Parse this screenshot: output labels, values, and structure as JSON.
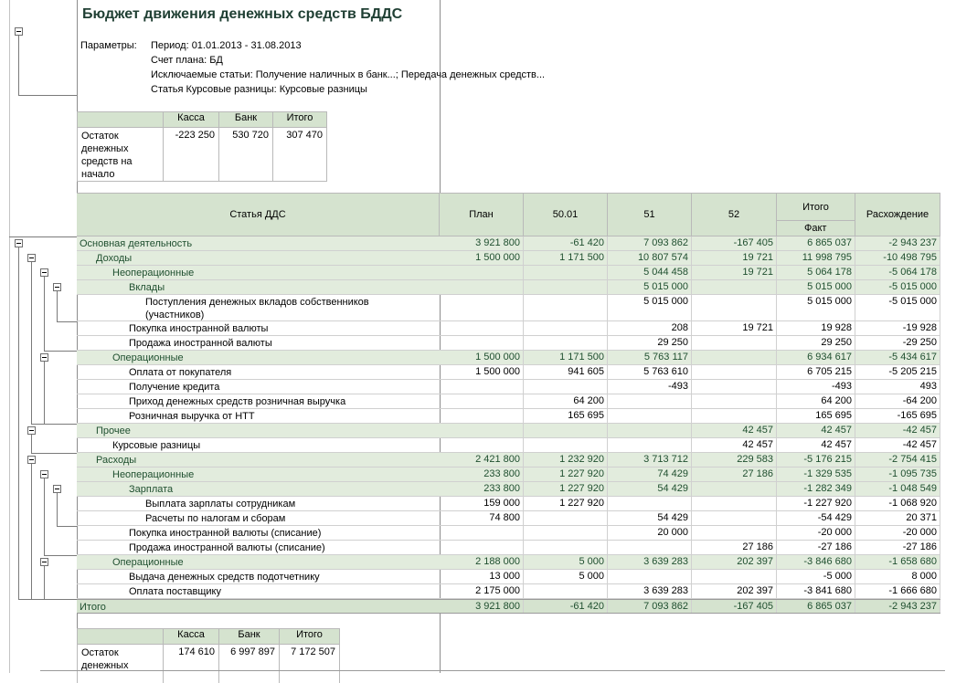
{
  "report": {
    "title": "Бюджет движения денежных средств БДДС",
    "params_label": "Параметры:",
    "params": [
      "Период: 01.01.2013 - 31.08.2013",
      "Счет плана: БД",
      "Исключаемые статьи: Получение наличных в банк...; Передача денежных средств...",
      "Статья Курсовые разницы: Курсовые разницы"
    ]
  },
  "opening_balance": {
    "headers": [
      "Касса",
      "Банк",
      "Итого"
    ],
    "label": "Остаток денежных средств на начало",
    "values": [
      "-223 250",
      "530 720",
      "307 470"
    ]
  },
  "main_table": {
    "headers": {
      "article": "Статья ДДС",
      "plan": "План",
      "c5001": "50.01",
      "c51": "51",
      "c52": "52",
      "total_group": "Итого",
      "fact": "Факт",
      "diff": "Расхождение"
    },
    "rows": [
      {
        "label": "Основная деятельность",
        "plan": "3 921 800",
        "c5001": "-61 420",
        "c51": "7 093 862",
        "c52": "-167 405",
        "fact": "6 865 037",
        "diff": "-2 943 237"
      },
      {
        "label": "Доходы",
        "plan": "1 500 000",
        "c5001": "1 171 500",
        "c51": "10 807 574",
        "c52": "19 721",
        "fact": "11 998 795",
        "diff": "-10 498 795"
      },
      {
        "label": "Неоперационные",
        "plan": "",
        "c5001": "",
        "c51": "5 044 458",
        "c52": "19 721",
        "fact": "5 064 178",
        "diff": "-5 064 178"
      },
      {
        "label": "Вклады",
        "plan": "",
        "c5001": "",
        "c51": "5 015 000",
        "c52": "",
        "fact": "5 015 000",
        "diff": "-5 015 000"
      },
      {
        "label_1": "Поступления денежных вкладов собственников",
        "label_2": "(участников)",
        "plan": "",
        "c5001": "",
        "c51": "5 015 000",
        "c52": "",
        "fact": "5 015 000",
        "diff": "-5 015 000"
      },
      {
        "label": "Покупка иностранной валюты",
        "plan": "",
        "c5001": "",
        "c51": "208",
        "c52": "19 721",
        "fact": "19 928",
        "diff": "-19 928"
      },
      {
        "label": "Продажа иностранной валюты",
        "plan": "",
        "c5001": "",
        "c51": "29 250",
        "c52": "",
        "fact": "29 250",
        "diff": "-29 250"
      },
      {
        "label": "Операционные",
        "plan": "1 500 000",
        "c5001": "1 171 500",
        "c51": "5 763 117",
        "c52": "",
        "fact": "6 934 617",
        "diff": "-5 434 617"
      },
      {
        "label": "Оплата от покупателя",
        "plan": "1 500 000",
        "c5001": "941 605",
        "c51": "5 763 610",
        "c52": "",
        "fact": "6 705 215",
        "diff": "-5 205 215"
      },
      {
        "label": "Получение кредита",
        "plan": "",
        "c5001": "",
        "c51": "-493",
        "c52": "",
        "fact": "-493",
        "diff": "493"
      },
      {
        "label": "Приход денежных средств розничная выручка",
        "plan": "",
        "c5001": "64 200",
        "c51": "",
        "c52": "",
        "fact": "64 200",
        "diff": "-64 200"
      },
      {
        "label": "Розничная выручка от НТТ",
        "plan": "",
        "c5001": "165 695",
        "c51": "",
        "c52": "",
        "fact": "165 695",
        "diff": "-165 695"
      },
      {
        "label": "Прочее",
        "plan": "",
        "c5001": "",
        "c51": "",
        "c52": "42 457",
        "fact": "42 457",
        "diff": "-42 457"
      },
      {
        "label": "Курсовые разницы",
        "plan": "",
        "c5001": "",
        "c51": "",
        "c52": "42 457",
        "fact": "42 457",
        "diff": "-42 457"
      },
      {
        "label": "Расходы",
        "plan": "2 421 800",
        "c5001": "1 232 920",
        "c51": "3 713 712",
        "c52": "229 583",
        "fact": "-5 176 215",
        "diff": "-2 754 415"
      },
      {
        "label": "Неоперационные",
        "plan": "233 800",
        "c5001": "1 227 920",
        "c51": "74 429",
        "c52": "27 186",
        "fact": "-1 329 535",
        "diff": "-1 095 735"
      },
      {
        "label": "Зарплата",
        "plan": "233 800",
        "c5001": "1 227 920",
        "c51": "54 429",
        "c52": "",
        "fact": "-1 282 349",
        "diff": "-1 048 549"
      },
      {
        "label": "Выплата зарплаты сотрудникам",
        "plan": "159 000",
        "c5001": "1 227 920",
        "c51": "",
        "c52": "",
        "fact": "-1 227 920",
        "diff": "-1 068 920"
      },
      {
        "label": "Расчеты по налогам и сборам",
        "plan": "74 800",
        "c5001": "",
        "c51": "54 429",
        "c52": "",
        "fact": "-54 429",
        "diff": "20 371"
      },
      {
        "label": "Покупка иностранной валюты (списание)",
        "plan": "",
        "c5001": "",
        "c51": "20 000",
        "c52": "",
        "fact": "-20 000",
        "diff": "-20 000"
      },
      {
        "label": "Продажа иностранной валюты (списание)",
        "plan": "",
        "c5001": "",
        "c51": "",
        "c52": "27 186",
        "fact": "-27 186",
        "diff": "-27 186"
      },
      {
        "label": "Операционные",
        "plan": "2 188 000",
        "c5001": "5 000",
        "c51": "3 639 283",
        "c52": "202 397",
        "fact": "-3 846 680",
        "diff": "-1 658 680"
      },
      {
        "label": "Выдача денежных средств подотчетнику",
        "plan": "13 000",
        "c5001": "5 000",
        "c51": "",
        "c52": "",
        "fact": "-5 000",
        "diff": "8 000"
      },
      {
        "label": "Оплата поставщику",
        "plan": "2 175 000",
        "c5001": "",
        "c51": "3 639 283",
        "c52": "202 397",
        "fact": "-3 841 680",
        "diff": "-1 666 680"
      },
      {
        "label": "Итого",
        "plan": "3 921 800",
        "c5001": "-61 420",
        "c51": "7 093 862",
        "c52": "-167 405",
        "fact": "6 865 037",
        "diff": "-2 943 237"
      }
    ]
  },
  "closing_balance": {
    "headers": [
      "Касса",
      "Банк",
      "Итого"
    ],
    "label_1": "Остаток",
    "label_2": "денежных",
    "values": [
      "174 610",
      "6 997 897",
      "7 172 507"
    ]
  }
}
